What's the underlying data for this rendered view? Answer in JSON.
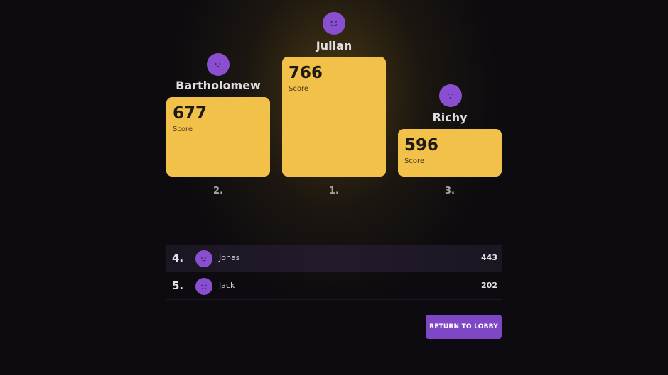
{
  "podium": [
    {
      "place_label": "2.",
      "name": "Bartholomew",
      "score": "677",
      "score_label": "Score",
      "avatar_icon": "purple-face-avatar"
    },
    {
      "place_label": "1.",
      "name": "Julian",
      "score": "766",
      "score_label": "Score",
      "avatar_icon": "purple-face-avatar"
    },
    {
      "place_label": "3.",
      "name": "Richy",
      "score": "596",
      "score_label": "Score",
      "avatar_icon": "purple-face-avatar"
    }
  ],
  "rest": [
    {
      "rank": "4.",
      "name": "Jonas",
      "score": "443",
      "avatar_icon": "purple-face-avatar"
    },
    {
      "rank": "5.",
      "name": "Jack",
      "score": "202",
      "avatar_icon": "purple-face-avatar"
    }
  ],
  "actions": {
    "return_label": "RETURN TO LOBBY"
  },
  "colors": {
    "podium_block": "#f2c14a",
    "avatar": "#8a4fd0",
    "button": "#7d47c5",
    "background": "#0d0b0f"
  }
}
